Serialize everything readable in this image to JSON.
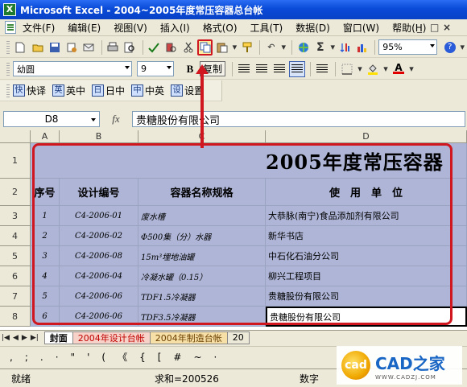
{
  "window": {
    "title": "Microsoft Excel - 2004~2005年度常压容器总台帐",
    "app_icon": "X",
    "min": "_",
    "restore": "□",
    "close": "×"
  },
  "menu": {
    "items": [
      "文件(F)",
      "编辑(E)",
      "视图(V)",
      "插入(I)",
      "格式(O)",
      "工具(T)",
      "数据(D)",
      "窗口(W)",
      "帮助(H)"
    ]
  },
  "toolbar": {
    "zoom": "95%",
    "sigma": "Σ",
    "undo": "↶",
    "help": "?"
  },
  "format_toolbar": {
    "font": "幼圆",
    "size": "9",
    "bold": "B",
    "copy_label": "复制",
    "font_color_label": "A"
  },
  "ime_toolbar": {
    "items": [
      "快译",
      "英中",
      "日中",
      "中英",
      "设置"
    ],
    "icons": [
      "快",
      "英",
      "日",
      "中",
      "设"
    ]
  },
  "formula_bar": {
    "cell_ref": "D8",
    "fx": "fx",
    "content": "贵糖股份有限公司"
  },
  "sheet": {
    "columns": [
      "A",
      "B",
      "C",
      "D"
    ],
    "rows": [
      "1",
      "2",
      "3",
      "4",
      "5",
      "6",
      "7",
      "8"
    ],
    "title": "2005年度常压容器",
    "headers": [
      "序号",
      "设计编号",
      "容器名称规格",
      "使　用　单　位"
    ],
    "data": [
      [
        "1",
        "C4-2006-01",
        "废水槽",
        "大恭脉(南宁)食品添加剂有限公司"
      ],
      [
        "2",
        "C4-2006-02",
        "Φ500集（分）水器",
        "新华书店"
      ],
      [
        "3",
        "C4-2006-08",
        "15m³埋地油罐",
        "中石化石油分公司"
      ],
      [
        "4",
        "C4-2006-04",
        "冷凝水罐（0.15）",
        "柳兴工程项目"
      ],
      [
        "5",
        "C4-2006-06",
        "TDF1.5冷凝器",
        "贵糖股份有限公司"
      ],
      [
        "6",
        "C4-2006-06",
        "TDF3.5冷凝器",
        "贵糖股份有限公司"
      ]
    ]
  },
  "tabs": {
    "items": [
      "封面",
      "2004年设计台帐",
      "2004年制造台帐",
      "20"
    ]
  },
  "symbols": [
    ",",
    ";",
    ".",
    "·",
    "\"",
    "'",
    "(",
    "《",
    "{",
    "[",
    "#",
    "~",
    "·"
  ],
  "status": {
    "ready": "就绪",
    "sum": "求和=200526",
    "numlock": "数字"
  },
  "watermark": {
    "name": "CAD之家",
    "url": "WWW.CADZJ.COM",
    "logo_text": "cad"
  },
  "colors": {
    "selection": "#aeb5d6",
    "highlight_red": "#d0161f",
    "title_blue": "#0a4ad8"
  }
}
